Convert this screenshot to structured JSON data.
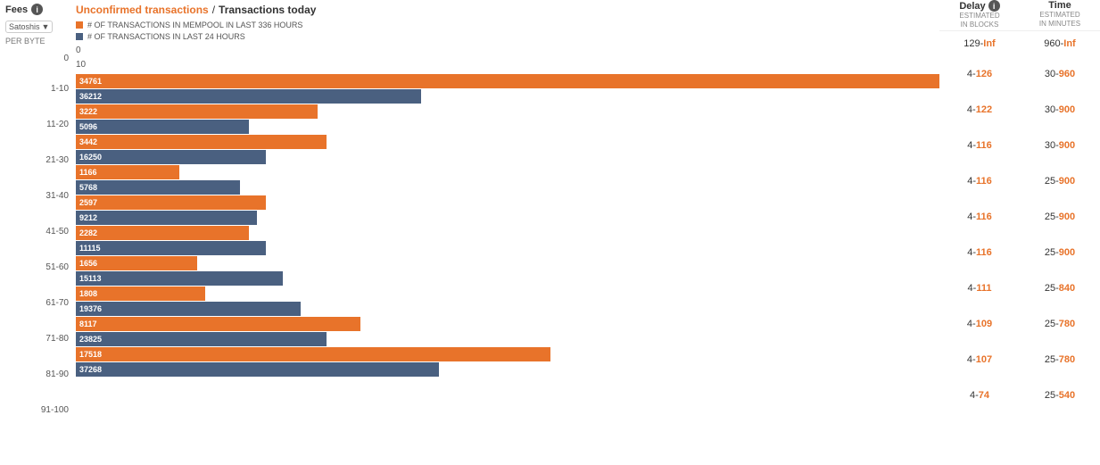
{
  "header": {
    "fees_label": "Fees",
    "unconfirmed_label": "Unconfirmed transactions",
    "separator": "/",
    "today_label": "Transactions today",
    "unit": "Satoshis",
    "per_byte": "PER BYTE"
  },
  "legend": {
    "orange_text": "# OF TRANSACTIONS IN MEMPOOL IN LAST 336 HOURS",
    "blue_text": "# OF TRANSACTIONS IN LAST 24 HOURS"
  },
  "delay_col": {
    "title": "Delay",
    "sub1": "ESTIMATED",
    "sub2": "IN BLOCKS"
  },
  "time_col": {
    "title": "Time",
    "sub1": "ESTIMATED",
    "sub2": "IN MINUTES"
  },
  "fee_rows": [
    {
      "range": "0",
      "orange_val": "0",
      "orange_pct": 0,
      "blue_val": "10",
      "blue_pct": 0,
      "delay": "129-Inf",
      "time": "960-Inf"
    },
    {
      "range": "1-10",
      "orange_val": "34761",
      "orange_pct": 100,
      "blue_val": "36212",
      "blue_pct": 40,
      "delay": "4-126",
      "time": "30-960"
    },
    {
      "range": "11-20",
      "orange_val": "3222",
      "orange_pct": 28,
      "blue_val": "5096",
      "blue_pct": 20,
      "delay": "4-122",
      "time": "30-900"
    },
    {
      "range": "21-30",
      "orange_val": "3442",
      "orange_pct": 29,
      "blue_val": "16250",
      "blue_pct": 22,
      "delay": "4-116",
      "time": "30-900"
    },
    {
      "range": "31-40",
      "orange_val": "1166",
      "orange_pct": 12,
      "blue_val": "5768",
      "blue_pct": 19,
      "delay": "4-116",
      "time": "25-900"
    },
    {
      "range": "41-50",
      "orange_val": "2597",
      "orange_pct": 22,
      "blue_val": "9212",
      "blue_pct": 21,
      "delay": "4-116",
      "time": "25-900"
    },
    {
      "range": "51-60",
      "orange_val": "2282",
      "orange_pct": 20,
      "blue_val": "11115",
      "blue_pct": 22,
      "delay": "4-116",
      "time": "25-900"
    },
    {
      "range": "61-70",
      "orange_val": "1656",
      "orange_pct": 14,
      "blue_val": "15113",
      "blue_pct": 24,
      "delay": "4-111",
      "time": "25-840"
    },
    {
      "range": "71-80",
      "orange_val": "1808",
      "orange_pct": 15,
      "blue_val": "19376",
      "blue_pct": 26,
      "delay": "4-109",
      "time": "25-780"
    },
    {
      "range": "81-90",
      "orange_val": "8117",
      "orange_pct": 33,
      "blue_val": "23825",
      "blue_pct": 29,
      "delay": "4-107",
      "time": "25-780"
    },
    {
      "range": "91-100",
      "orange_val": "17518",
      "orange_pct": 55,
      "blue_val": "37268",
      "blue_pct": 42,
      "delay": "4-74",
      "time": "25-540"
    }
  ]
}
